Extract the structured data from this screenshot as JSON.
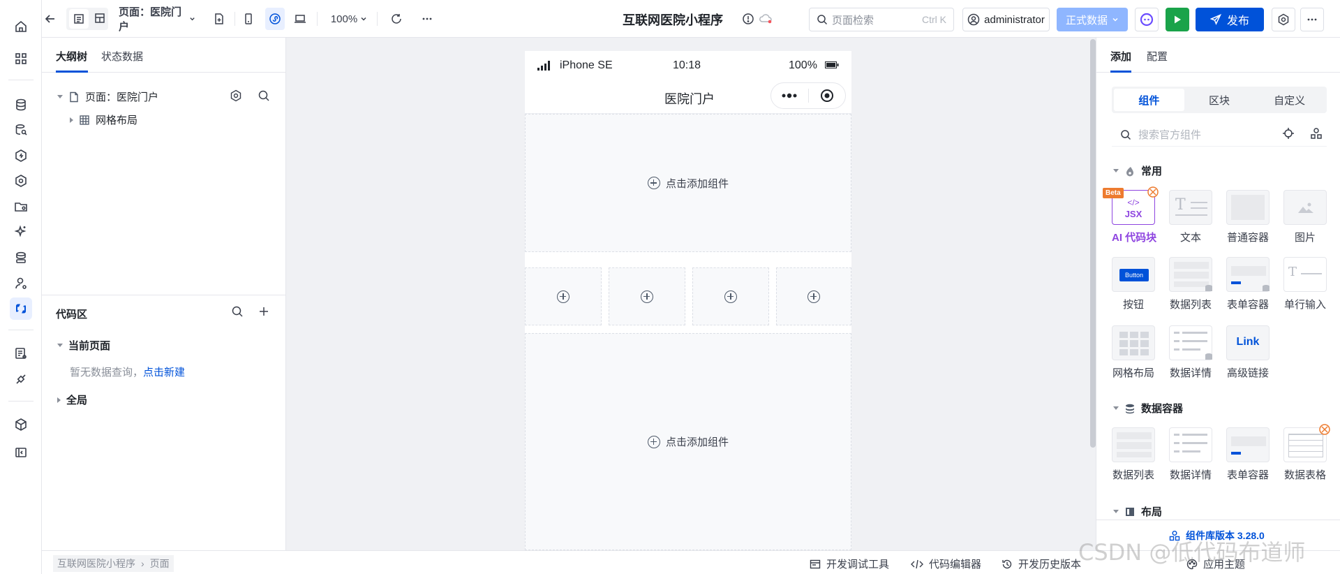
{
  "topbar": {
    "page_selector": "页面：医院门户",
    "zoom": "100%",
    "app_title": "互联网医院小程序",
    "search_placeholder": "页面检索",
    "search_shortcut": "Ctrl K",
    "user": "administrator",
    "data_env": "正式数据",
    "publish": "发布"
  },
  "left_panel": {
    "tabs": [
      "大纲树",
      "状态数据"
    ],
    "tree": [
      {
        "label": "页面：医院门户"
      },
      {
        "label": "网格布局"
      }
    ],
    "code_section": {
      "title": "代码区",
      "current_page": "当前页面",
      "empty_text": "暂无数据查询，",
      "create_link": "点击新建",
      "global": "全局"
    }
  },
  "canvas": {
    "device": "iPhone SE",
    "time": "10:18",
    "battery": "100%",
    "page_title": "医院门户",
    "add_component": "点击添加组件"
  },
  "right_panel": {
    "tabs": [
      "添加",
      "配置"
    ],
    "segments": [
      "组件",
      "区块",
      "自定义"
    ],
    "search_placeholder": "搜索官方组件",
    "sections": [
      {
        "title": "常用",
        "items": [
          "AI 代码块",
          "文本",
          "普通容器",
          "图片",
          "按钮",
          "数据列表",
          "表单容器",
          "单行输入",
          "网格布局",
          "数据详情",
          "高级链接"
        ]
      },
      {
        "title": "数据容器",
        "items": [
          "数据列表",
          "数据详情",
          "表单容器",
          "数据表格"
        ]
      },
      {
        "title": "布局",
        "items": []
      }
    ],
    "beta_badge": "Beta",
    "jsx_label": "JSX",
    "button_thumb": "Button",
    "link_thumb": "Link",
    "lib_version": "组件库版本 3.28.0",
    "theme": "应用主题"
  },
  "bottombar": {
    "breadcrumb": [
      "互联网医院小程序",
      "页面"
    ],
    "tools": [
      "开发调试工具",
      "代码编辑器",
      "开发历史版本"
    ]
  },
  "watermark": "CSDN @低代码布道师",
  "colors": {
    "primary": "#0052d9",
    "run": "#1aa34a",
    "data_env": "#8fb6ff",
    "ai_purple": "#8e44e0",
    "beta_orange": "#ed7b2f"
  }
}
